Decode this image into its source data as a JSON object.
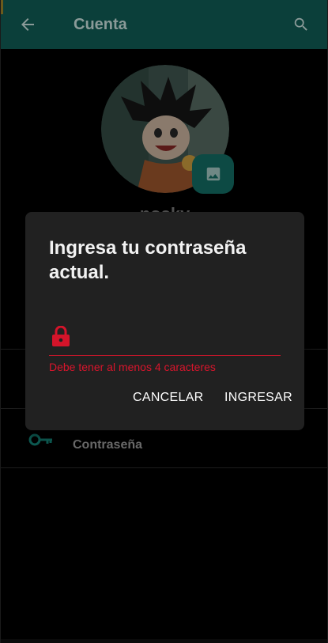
{
  "appbar": {
    "title": "Cuenta",
    "back_icon": "arrow-back-icon",
    "search_icon": "search-icon",
    "background": "#0b3f3a"
  },
  "profile": {
    "username": "nosky",
    "avatar": "goku-avatar-image",
    "photo_button_icon": "image-icon"
  },
  "settings": {
    "password_row_label": "Contraseña",
    "password_row_icon": "key-icon"
  },
  "dialog": {
    "title": "Ingresa tu contraseña actual.",
    "field_icon": "lock-icon",
    "password_value": "",
    "error_text": "Debe tener al menos 4 caracteres",
    "cancel_label": "CANCELAR",
    "submit_label": "INGRESAR",
    "error_color": "#d9152c"
  }
}
